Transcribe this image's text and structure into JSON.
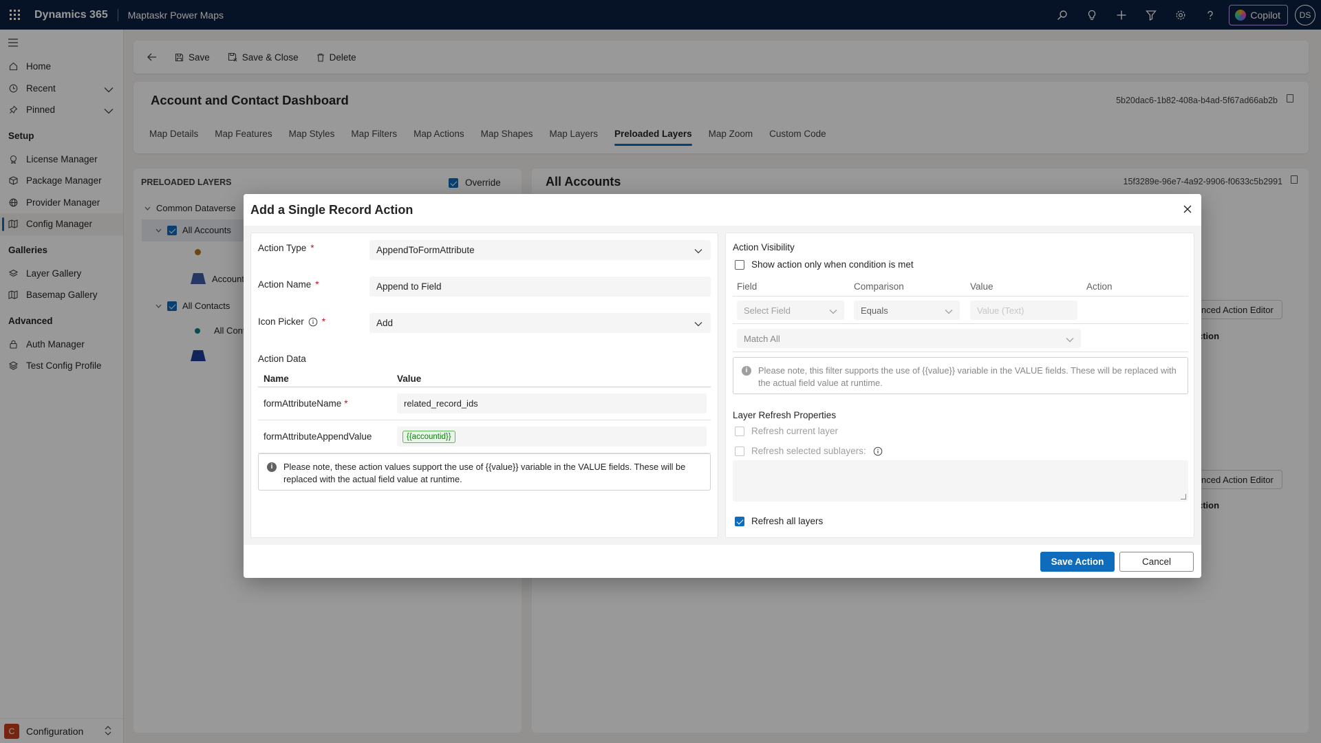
{
  "topbar": {
    "app_name": "Dynamics 365",
    "app_subtitle": "Maptaskr Power Maps",
    "copilot_label": "Copilot",
    "avatar_initials": "DS"
  },
  "sidebar": {
    "items": [
      {
        "label": "Home",
        "icon": "home-icon"
      },
      {
        "label": "Recent",
        "icon": "clock-icon"
      },
      {
        "label": "Pinned",
        "icon": "pin-icon"
      }
    ],
    "setup_heading": "Setup",
    "setup_items": [
      "License Manager",
      "Package Manager",
      "Provider Manager",
      "Config Manager"
    ],
    "galleries_heading": "Galleries",
    "gallery_items": [
      "Layer Gallery",
      "Basemap Gallery"
    ],
    "advanced_heading": "Advanced",
    "advanced_items": [
      "Auth Manager",
      "Test Config Profile"
    ],
    "area": {
      "badge": "C",
      "label": "Configuration"
    }
  },
  "commandbar": {
    "save": "Save",
    "save_close": "Save & Close",
    "delete": "Delete"
  },
  "record": {
    "title": "Account and Contact Dashboard",
    "id": "5b20dac6-1b82-408a-b4ad-5f67ad66ab2b",
    "tabs": [
      "Map Details",
      "Map Features",
      "Map Styles",
      "Map Filters",
      "Map Actions",
      "Map Shapes",
      "Map Layers",
      "Preloaded Layers",
      "Map Zoom",
      "Custom Code"
    ],
    "selected_tab": "Preloaded Layers"
  },
  "left_panel": {
    "title": "PRELOADED LAYERS",
    "override_label": "Override",
    "tree": {
      "root": "Common Dataverse",
      "accounts": "All Accounts",
      "accounts_sub": "Account",
      "contacts": "All Contacts",
      "contacts_sub": "All Cont"
    }
  },
  "right_panel": {
    "title": "All Accounts",
    "id": "15f3289e-96e7-4a92-9906-f0633c5b2991",
    "adv_button_1": "nced Action Editor",
    "col_1": "ction",
    "adv_button_2": "nced Action Editor",
    "col_2": "ction"
  },
  "dialog": {
    "title": "Add a Single Record Action",
    "left": {
      "action_type_label": "Action Type",
      "action_type_value": "AppendToFormAttribute",
      "action_name_label": "Action Name",
      "action_name_value": "Append to Field",
      "icon_picker_label": "Icon Picker",
      "icon_picker_value": "Add",
      "action_data_label": "Action Data",
      "col_name": "Name",
      "col_value": "Value",
      "rows": [
        {
          "name": "formAttributeName",
          "value": "related_record_ids",
          "required": true
        },
        {
          "name": "formAttributeAppendValue",
          "value": "{{accountid}}",
          "required": false
        }
      ],
      "note": "Please note, these action values support the use of {{value}} variable in the VALUE fields. These will be replaced with the actual field value at runtime."
    },
    "right": {
      "visibility_title": "Action Visibility",
      "show_only_label": "Show action only when condition is met",
      "cols": [
        "Field",
        "Comparison",
        "Value",
        "Action"
      ],
      "field_placeholder": "Select Field",
      "comparison_value": "Equals",
      "value_placeholder": "Value (Text)",
      "match_value": "Match All",
      "note": "Please note, this filter supports the use of {{value}} variable in the VALUE fields. These will be replaced with the actual field value at runtime.",
      "refresh_title": "Layer Refresh Properties",
      "refresh_current": "Refresh current layer",
      "refresh_selected": "Refresh selected sublayers:",
      "refresh_all": "Refresh all layers"
    },
    "save_label": "Save Action",
    "cancel_label": "Cancel"
  },
  "colors": {
    "topbar": "#0b1e3f",
    "accent": "#0f6cbd",
    "required": "#c50f1f",
    "area_badge": "#c43e1c"
  }
}
